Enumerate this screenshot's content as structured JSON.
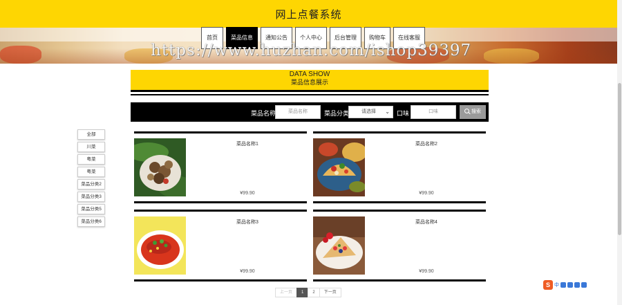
{
  "header": {
    "title": "网上点餐系统",
    "accent": "#fed602"
  },
  "nav": {
    "items": [
      {
        "label": "首页"
      },
      {
        "label": "菜品信息"
      },
      {
        "label": "通知公告"
      },
      {
        "label": "个人中心"
      },
      {
        "label": "后台管理"
      },
      {
        "label": "购物车"
      },
      {
        "label": "在线客服"
      }
    ],
    "active": "菜品信息"
  },
  "watermark": "https://www.huzhan.com/ishop39397",
  "section": {
    "en": "DATA SHOW",
    "cn": "菜品信息展示"
  },
  "search": {
    "name_label": "菜品名称",
    "name_placeholder": "菜品名称",
    "category_label": "菜品分类",
    "category_selected": "请选择",
    "taste_label": "口味",
    "taste_placeholder": "口味",
    "button_label": "搜索"
  },
  "categories": [
    "全部",
    "川菜",
    "粤菜",
    "粤菜",
    "菜品分类2",
    "菜品分类3",
    "菜品分类5",
    "菜品分类6"
  ],
  "products": [
    {
      "name": "菜品名称1",
      "price": "¥99.90",
      "image": "stir-fried-mushrooms"
    },
    {
      "name": "菜品名称2",
      "price": "¥99.90",
      "image": "tacos"
    },
    {
      "name": "菜品名称3",
      "price": "¥99.90",
      "image": "chili-fish"
    },
    {
      "name": "菜品名称4",
      "price": "¥99.90",
      "image": "crepe-with-strawberries"
    }
  ],
  "pagination": {
    "prev": "上一页",
    "pages": [
      "1",
      "2"
    ],
    "current": "1",
    "next": "下一页"
  },
  "ime": {
    "text": "中",
    "icons": [
      "moon-icon",
      "mic-icon",
      "keyboard-icon",
      "grid-icon"
    ]
  }
}
